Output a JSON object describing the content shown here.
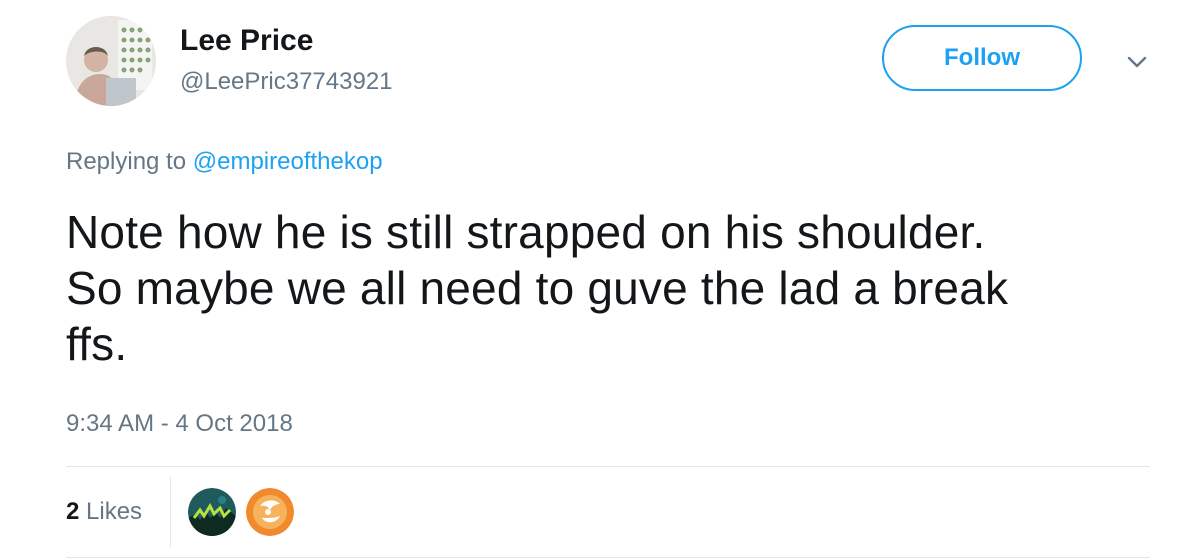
{
  "author": {
    "display_name": "Lee Price",
    "handle": "@LeePric37743921",
    "avatar_icon": "profile-photo"
  },
  "header": {
    "follow_label": "Follow",
    "menu_icon": "chevron-down-icon"
  },
  "reply": {
    "prefix": "Replying to",
    "mention": "@empireofthekop"
  },
  "tweet": {
    "text_lines": [
      "Note how he is still strapped on his shoulder.",
      "So maybe we all need to guve the lad a break",
      "ffs."
    ],
    "timestamp": "9:34 AM - 4 Oct 2018"
  },
  "engagement": {
    "likes_count": "2",
    "likes_label": "Likes",
    "likers": [
      {
        "icon": "liker-avatar-dark-green"
      },
      {
        "icon": "liker-avatar-orange"
      }
    ]
  },
  "colors": {
    "accent": "#1da1f2",
    "text_primary": "#14171a",
    "text_secondary": "#657786",
    "divider": "#e1e8ed"
  }
}
